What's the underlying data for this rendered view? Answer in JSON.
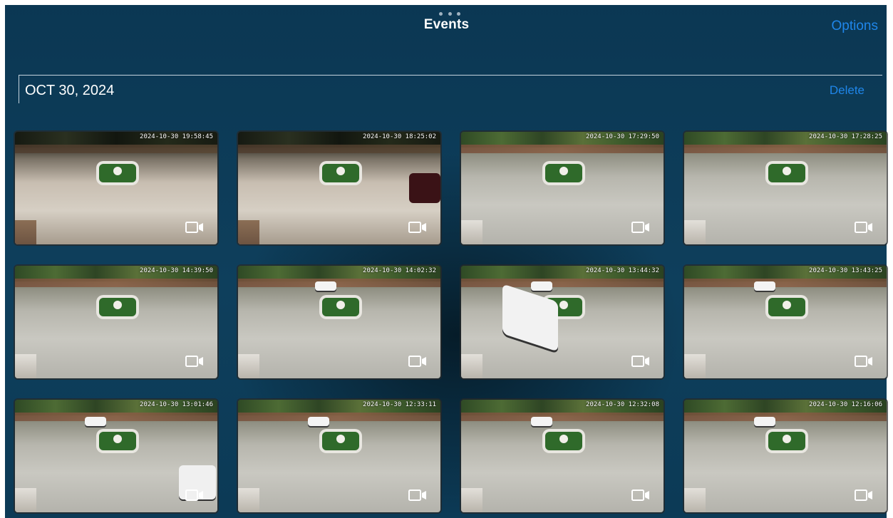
{
  "header": {
    "title": "Events",
    "options_label": "Options"
  },
  "section": {
    "date_label": "OCT 30, 2024",
    "delete_label": "Delete"
  },
  "events": [
    {
      "timestamp": "2024-10-30 19:58:45",
      "scene": "night"
    },
    {
      "timestamp": "2024-10-30 18:25:02",
      "scene": "night"
    },
    {
      "timestamp": "2024-10-30 17:29:50",
      "scene": "day"
    },
    {
      "timestamp": "2024-10-30 17:28:25",
      "scene": "day"
    },
    {
      "timestamp": "2024-10-30 14:39:50",
      "scene": "day"
    },
    {
      "timestamp": "2024-10-30 14:02:32",
      "scene": "day"
    },
    {
      "timestamp": "2024-10-30 13:44:32",
      "scene": "day"
    },
    {
      "timestamp": "2024-10-30 13:43:25",
      "scene": "day"
    },
    {
      "timestamp": "2024-10-30 13:01:46",
      "scene": "day"
    },
    {
      "timestamp": "2024-10-30 12:33:11",
      "scene": "day"
    },
    {
      "timestamp": "2024-10-30 12:32:08",
      "scene": "day"
    },
    {
      "timestamp": "2024-10-30 12:16:06",
      "scene": "day"
    }
  ],
  "icons": {
    "more": "ellipsis-icon",
    "video": "video-camera-icon"
  },
  "colors": {
    "background": "#0d3a55",
    "accent": "#1f86ea",
    "text": "#ffffff"
  }
}
